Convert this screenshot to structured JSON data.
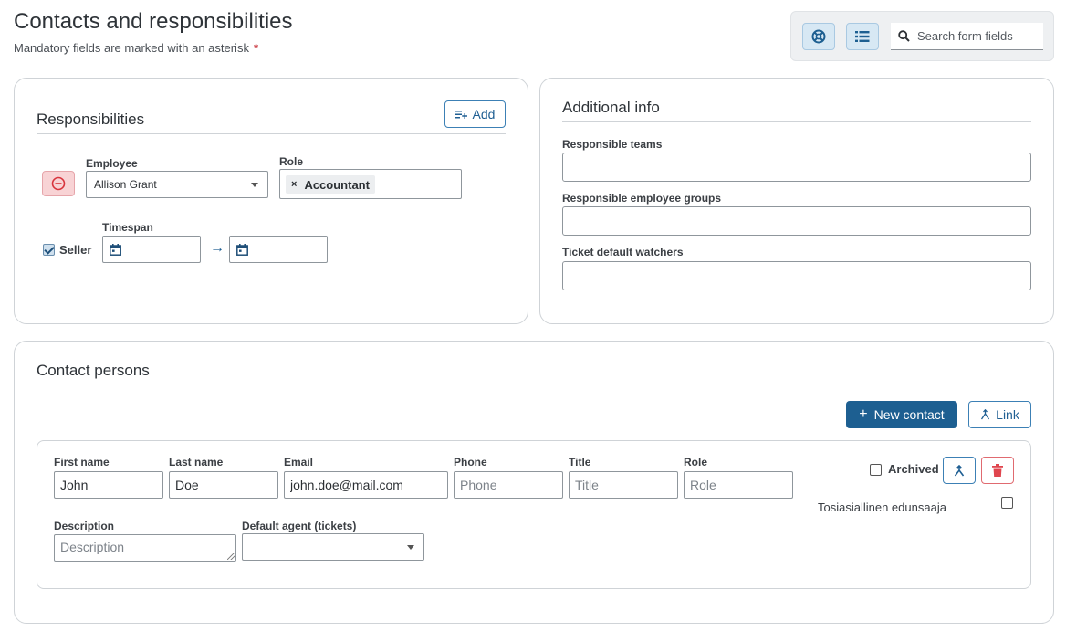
{
  "header": {
    "title": "Contacts and responsibilities",
    "subtitle": "Mandatory fields are marked with an asterisk",
    "asterisk": "*"
  },
  "toolbar": {
    "help_icon": "lifebuoy-icon",
    "list_icon": "list-view-icon",
    "search_placeholder": "Search form fields"
  },
  "responsibilities": {
    "title": "Responsibilities",
    "add_label": "Add",
    "employee_label": "Employee",
    "employee_value": "Allison Grant",
    "role_label": "Role",
    "role_tag": "Accountant",
    "role_tag_remove": "×",
    "seller_label": "Seller",
    "seller_checked": true,
    "timespan_label": "Timespan",
    "timespan_arrow": "→"
  },
  "additional_info": {
    "title": "Additional info",
    "responsible_teams_label": "Responsible teams",
    "responsible_groups_label": "Responsible employee groups",
    "ticket_watchers_label": "Ticket default watchers"
  },
  "contact_persons": {
    "title": "Contact persons",
    "new_contact_label": "New contact",
    "new_contact_plus": "+",
    "link_label": "Link",
    "contact": {
      "first_name_label": "First name",
      "first_name_value": "John",
      "last_name_label": "Last name",
      "last_name_value": "Doe",
      "email_label": "Email",
      "email_value": "john.doe@mail.com",
      "phone_label": "Phone",
      "phone_placeholder": "Phone",
      "title_label": "Title",
      "title_placeholder": "Title",
      "role_label": "Role",
      "role_placeholder": "Role",
      "archived_label": "Archived",
      "beneficiary_label": "Tosiasiallinen edunsaaja",
      "description_label": "Description",
      "description_placeholder": "Description",
      "default_agent_label": "Default agent (tickets)",
      "default_agent_value": ""
    }
  },
  "colors": {
    "primary": "#1d5f91",
    "danger": "#e0464e",
    "accent_light": "#d7e8f4"
  }
}
